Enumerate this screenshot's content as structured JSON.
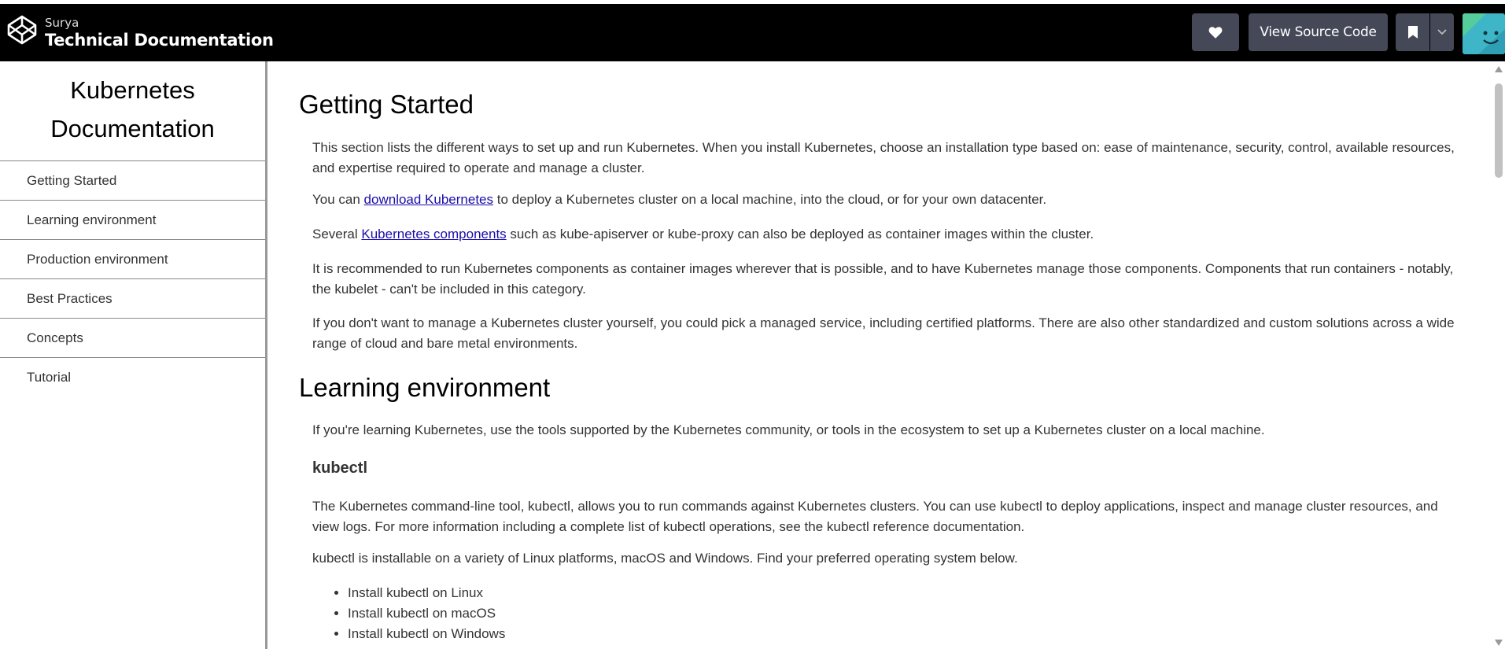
{
  "header": {
    "brand_sub": "Surya",
    "brand_title": "Technical Documentation",
    "view_source_label": "View Source Code",
    "icons": [
      "codepen-logo-icon",
      "heart-icon",
      "bookmark-icon",
      "chevron-down-icon",
      "avatar"
    ]
  },
  "sidebar": {
    "title": "Kubernetes Documentation",
    "items": [
      {
        "label": "Getting Started"
      },
      {
        "label": "Learning environment"
      },
      {
        "label": "Production environment"
      },
      {
        "label": "Best Practices"
      },
      {
        "label": "Concepts"
      },
      {
        "label": "Tutorial"
      }
    ]
  },
  "main": {
    "getting_started": {
      "heading": "Getting Started",
      "p1": "This section lists the different ways to set up and run Kubernetes. When you install Kubernetes, choose an installation type based on: ease of maintenance, security, control, available resources, and expertise required to operate and manage a cluster.",
      "p2_pre": "You can ",
      "p2_link": "download Kubernetes",
      "p2_post": " to deploy a Kubernetes cluster on a local machine, into the cloud, or for your own datacenter.",
      "p3_pre": "Several ",
      "p3_link": "Kubernetes components",
      "p3_post": " such as kube-apiserver or kube-proxy can also be deployed as container images within the cluster.",
      "p4": "It is recommended to run Kubernetes components as container images wherever that is possible, and to have Kubernetes manage those components. Components that run containers - notably, the kubelet - can't be included in this category.",
      "p5": "If you don't want to manage a Kubernetes cluster yourself, you could pick a managed service, including certified platforms. There are also other standardized and custom solutions across a wide range of cloud and bare metal environments."
    },
    "learning_environment": {
      "heading": "Learning environment",
      "p1": "If you're learning Kubernetes, use the tools supported by the Kubernetes community, or tools in the ecosystem to set up a Kubernetes cluster on a local machine.",
      "subheading": "kubectl",
      "p2": "The Kubernetes command-line tool, kubectl, allows you to run commands against Kubernetes clusters. You can use kubectl to deploy applications, inspect and manage cluster resources, and view logs. For more information including a complete list of kubectl operations, see the kubectl reference documentation.",
      "p3": "kubectl is installable on a variety of Linux platforms, macOS and Windows. Find your preferred operating system below.",
      "list": [
        "Install kubectl on Linux",
        "Install kubectl on macOS",
        "Install kubectl on Windows"
      ]
    }
  },
  "colors": {
    "topbar": "#000000",
    "button": "#444857",
    "link": "#1a0dab",
    "sidebar_border": "#999999"
  }
}
